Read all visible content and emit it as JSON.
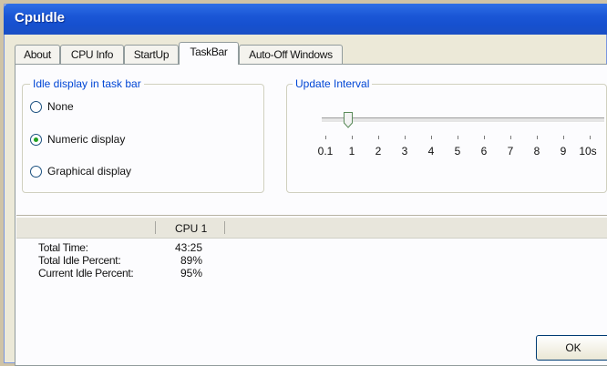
{
  "window": {
    "title": "CpuIdle"
  },
  "tabs": [
    {
      "label": "About"
    },
    {
      "label": "CPU Info"
    },
    {
      "label": "StartUp"
    },
    {
      "label": "TaskBar"
    },
    {
      "label": "Auto-Off Windows"
    }
  ],
  "active_tab": "TaskBar",
  "idle_group": {
    "legend": "Idle display in task bar",
    "options": [
      {
        "label": "None",
        "checked": false
      },
      {
        "label": "Numeric display",
        "checked": true
      },
      {
        "label": "Graphical display",
        "checked": false
      }
    ]
  },
  "update_group": {
    "legend": "Update Interval",
    "ticks": [
      "0.1",
      "1",
      "2",
      "3",
      "4",
      "5",
      "6",
      "7",
      "8",
      "9",
      "10s"
    ],
    "selected": "1"
  },
  "info_table": {
    "column": "CPU 1",
    "rows": [
      {
        "label": "Total Time:",
        "value": "43:25"
      },
      {
        "label": "Total Idle Percent:",
        "value": "89%"
      },
      {
        "label": "Current Idle Percent:",
        "value": "95%"
      }
    ]
  },
  "buttons": {
    "ok": "OK"
  },
  "colors": {
    "title_bar": "#1a56d6",
    "legend_text": "#0046d5",
    "radio_check": "#21a121"
  }
}
